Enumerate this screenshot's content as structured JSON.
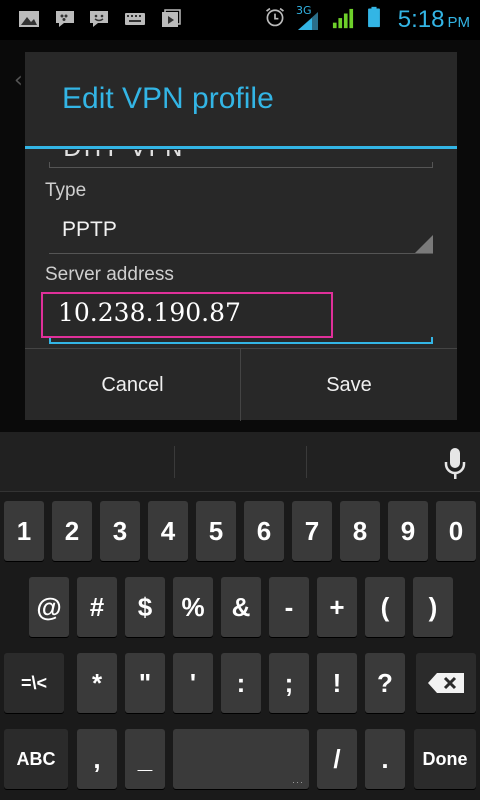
{
  "status_bar": {
    "network": "3G",
    "time": "5:18",
    "ampm": "PM",
    "accent_color": "#33b5e5",
    "icons": [
      "gallery-icon",
      "bbm-icon",
      "chat-icon",
      "keyboard-icon",
      "media-icon",
      "alarm-icon",
      "signal-3g-icon",
      "signal-icon",
      "battery-icon"
    ]
  },
  "dialog": {
    "title": "Edit VPN profile",
    "cut_field_text": "DHT VPN",
    "type_label": "Type",
    "type_value": "PPTP",
    "server_label": "Server address",
    "server_value": "10.238.190.87",
    "cancel_label": "Cancel",
    "save_label": "Save",
    "highlight_color": "#e0309a"
  },
  "keyboard": {
    "row1": [
      "1",
      "2",
      "3",
      "4",
      "5",
      "6",
      "7",
      "8",
      "9",
      "0"
    ],
    "row2": [
      "@",
      "#",
      "$",
      "%",
      "&",
      "-",
      "+",
      "(",
      ")"
    ],
    "row3": [
      "=\\<",
      "*",
      "\"",
      "'",
      ":",
      ";",
      "!",
      "?"
    ],
    "row4": {
      "abc": "ABC",
      "comma": ",",
      "underscore": "_",
      "slash": "/",
      "period": ".",
      "done": "Done"
    }
  }
}
